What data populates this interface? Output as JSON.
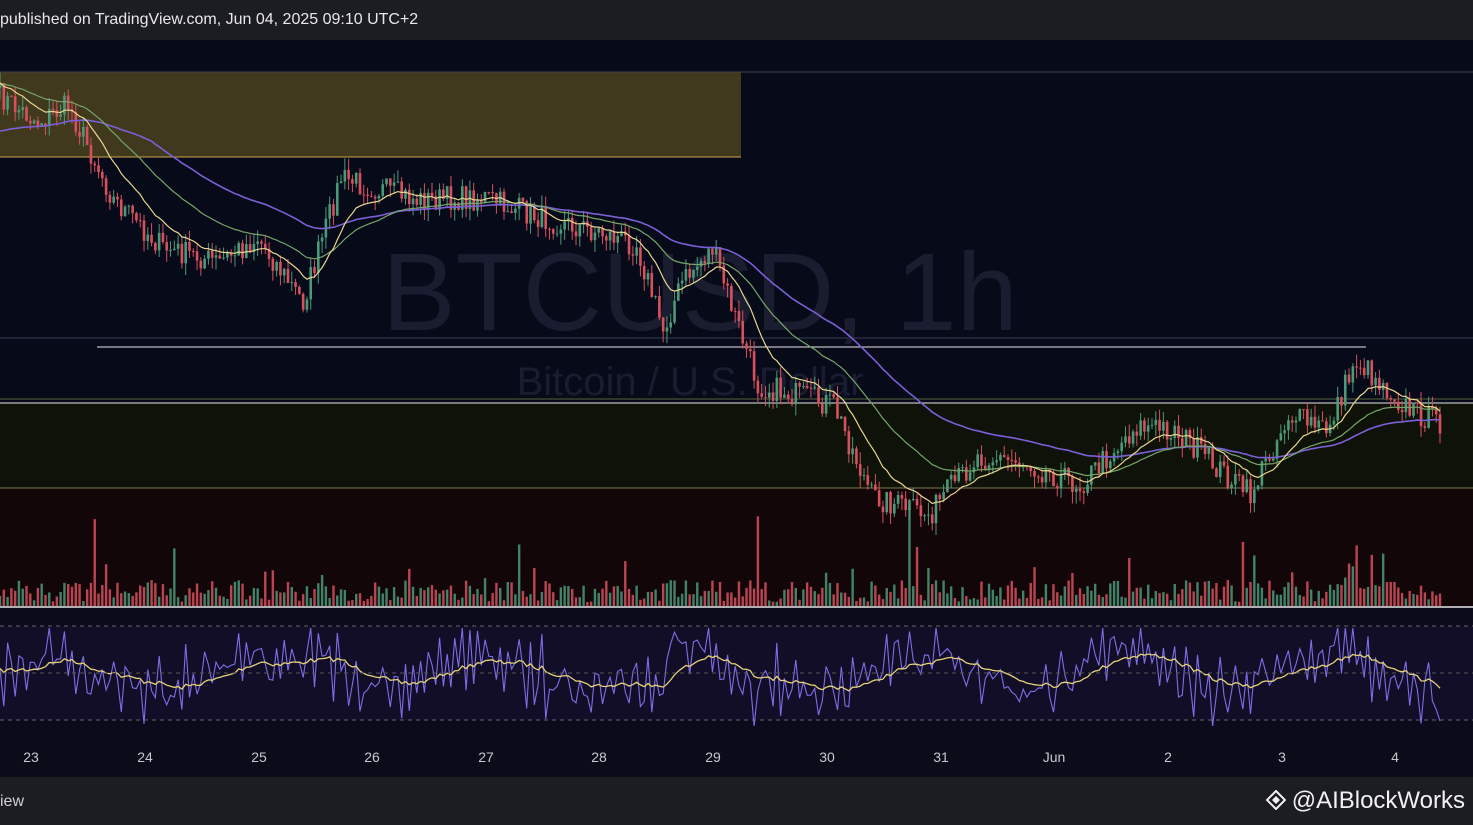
{
  "header": {
    "published": "published on TradingView.com, Jun 04, 2025 09:10 UTC+2"
  },
  "footer": {
    "brand": "iew",
    "watermark": "@AIBlockWorks"
  },
  "colors": {
    "background": "#070a18",
    "bull": "#4a9a7a",
    "bear": "#d8505e",
    "ema_fast": "#e8d690",
    "ema_mid": "#76a66a",
    "ema_slow": "#7b5fd6",
    "rsi": "#7e6ee8",
    "rsi_ma": "#e5d27a",
    "supply_zone": "#4a4220"
  },
  "chart_data": {
    "type": "candlestick",
    "symbol_watermark": "BTCUSD, 1h",
    "symbol_desc": "Bitcoin / U.S. Dollar",
    "x_ticks": [
      "23",
      "24",
      "25",
      "26",
      "27",
      "28",
      "29",
      "30",
      "31",
      "Jun",
      "2",
      "3",
      "4"
    ],
    "overlays": [
      "EMA fast",
      "EMA mid",
      "EMA slow",
      "Volume",
      "RSI with moving average"
    ],
    "key_points": [
      {
        "t": 0,
        "close": 96
      },
      {
        "t": 10,
        "close": 122
      },
      {
        "t": 18,
        "close": 105
      },
      {
        "t": 30,
        "close": 200
      },
      {
        "t": 43,
        "close": 248
      },
      {
        "t": 58,
        "close": 262
      },
      {
        "t": 68,
        "close": 238
      },
      {
        "t": 80,
        "close": 302
      },
      {
        "t": 90,
        "close": 178
      },
      {
        "t": 110,
        "close": 200
      },
      {
        "t": 128,
        "close": 198
      },
      {
        "t": 143,
        "close": 218
      },
      {
        "t": 158,
        "close": 232
      },
      {
        "t": 168,
        "close": 244
      },
      {
        "t": 175,
        "close": 330
      },
      {
        "t": 180,
        "close": 282
      },
      {
        "t": 188,
        "close": 248
      },
      {
        "t": 200,
        "close": 385
      },
      {
        "t": 220,
        "close": 405
      },
      {
        "t": 230,
        "close": 496
      },
      {
        "t": 245,
        "close": 515
      },
      {
        "t": 258,
        "close": 456
      },
      {
        "t": 270,
        "close": 462
      },
      {
        "t": 285,
        "close": 485
      },
      {
        "t": 300,
        "close": 426
      },
      {
        "t": 310,
        "close": 430
      },
      {
        "t": 322,
        "close": 470
      },
      {
        "t": 330,
        "close": 495
      },
      {
        "t": 340,
        "close": 415
      },
      {
        "t": 350,
        "close": 430
      },
      {
        "t": 358,
        "close": 360
      },
      {
        "t": 372,
        "close": 410
      },
      {
        "t": 380,
        "close": 422
      }
    ],
    "zones": [
      {
        "label": "supply",
        "y_from": 72,
        "y_to": 157,
        "x_to_t": 196
      },
      {
        "label": "range-top",
        "y": 403
      },
      {
        "label": "range-bottom",
        "y": 488
      }
    ]
  }
}
